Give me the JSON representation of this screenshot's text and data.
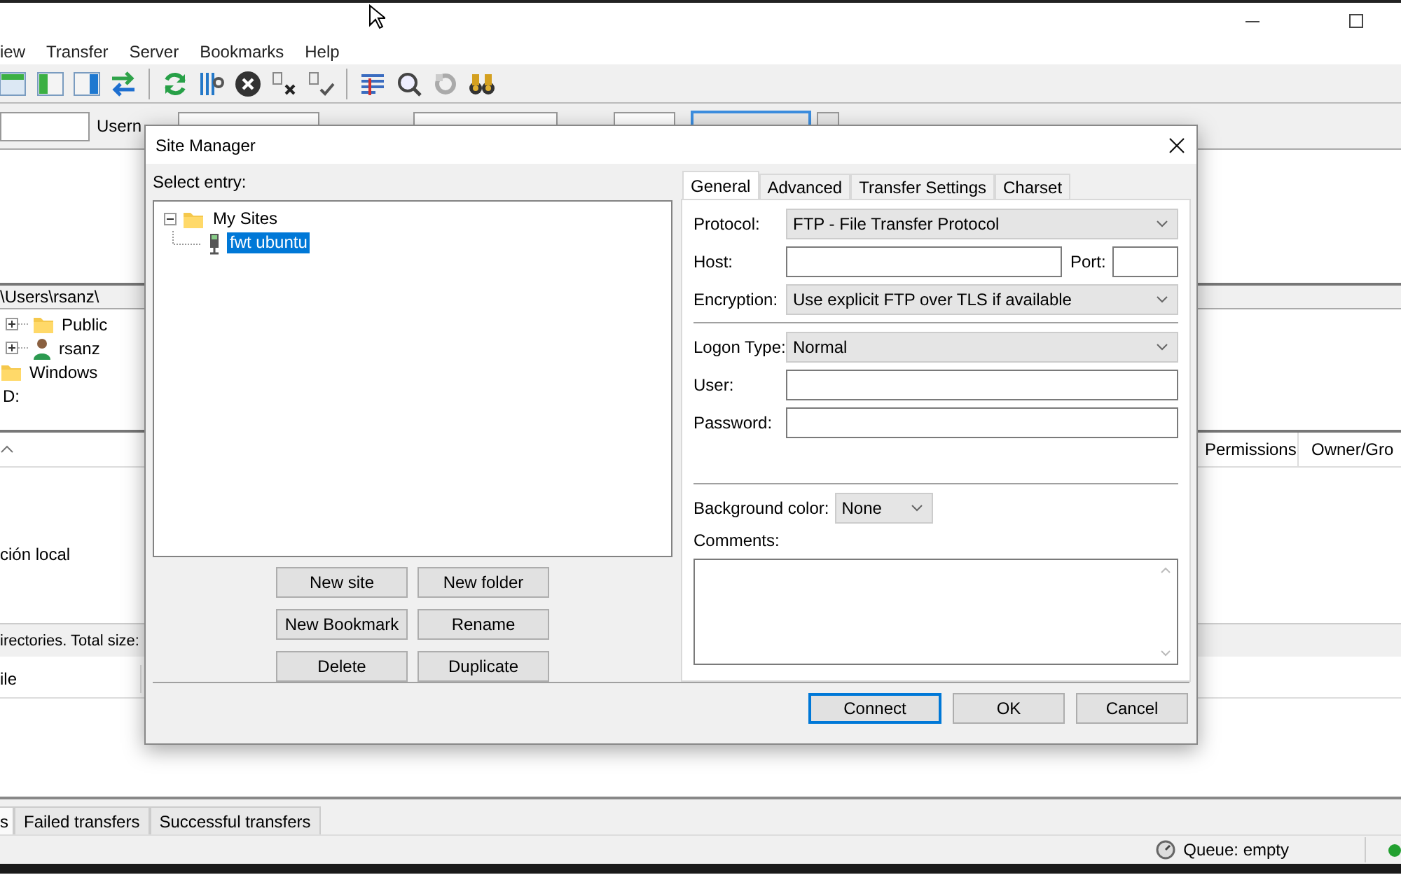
{
  "menu": [
    {
      "label": "iew"
    },
    {
      "label": "Transfer"
    },
    {
      "label": "Server"
    },
    {
      "label": "Bookmarks"
    },
    {
      "label": "Help"
    }
  ],
  "quickconnect": {
    "username_label": "Usern"
  },
  "local_path": "\\Users\\rsanz\\",
  "local_tree": [
    {
      "label": "Public",
      "kind": "folder",
      "collapsed": true
    },
    {
      "label": "rsanz",
      "kind": "user",
      "collapsed": true
    },
    {
      "label": "Windows",
      "kind": "folder",
      "collapsed": false
    },
    {
      "label": "D:",
      "kind": "drive",
      "collapsed": false
    }
  ],
  "local_files": {
    "rows": [
      {
        "name": "ción local"
      }
    ],
    "status": "irectories. Total size:"
  },
  "remote_columns": [
    {
      "label": "Permissions"
    },
    {
      "label": "Owner/Gro"
    }
  ],
  "queue_columns": [
    {
      "label": "ile"
    }
  ],
  "bottom_tabs": [
    {
      "label": "s",
      "selected": true
    },
    {
      "label": "Failed transfers",
      "selected": false
    },
    {
      "label": "Successful transfers",
      "selected": false
    }
  ],
  "status_bar": {
    "queue": "Queue: empty"
  },
  "site_manager": {
    "title": "Site Manager",
    "select_label": "Select entry:",
    "tree": [
      {
        "label": "My Sites",
        "kind": "folder",
        "expanded": true,
        "selected": false,
        "children": [
          {
            "label": "fwt ubuntu",
            "kind": "server",
            "selected": true
          }
        ]
      }
    ],
    "entry_buttons": [
      "New site",
      "New folder",
      "New Bookmark",
      "Rename",
      "Delete",
      "Duplicate"
    ],
    "tabs": [
      {
        "label": "General",
        "selected": true
      },
      {
        "label": "Advanced",
        "selected": false
      },
      {
        "label": "Transfer Settings",
        "selected": false
      },
      {
        "label": "Charset",
        "selected": false
      }
    ],
    "protocol": {
      "label": "Protocol:",
      "value": "FTP - File Transfer Protocol"
    },
    "host": {
      "label": "Host:"
    },
    "port": {
      "label": "Port:"
    },
    "encryption": {
      "label": "Encryption:",
      "value": "Use explicit FTP over TLS if available"
    },
    "logon_type": {
      "label": "Logon Type:",
      "value": "Normal"
    },
    "user": {
      "label": "User:"
    },
    "password": {
      "label": "Password:"
    },
    "background_color": {
      "label": "Background color:",
      "value": "None"
    },
    "comments": {
      "label": "Comments:"
    },
    "buttons": [
      {
        "label": "Connect",
        "default": true
      },
      {
        "label": "OK",
        "default": false
      },
      {
        "label": "Cancel",
        "default": false
      }
    ]
  }
}
